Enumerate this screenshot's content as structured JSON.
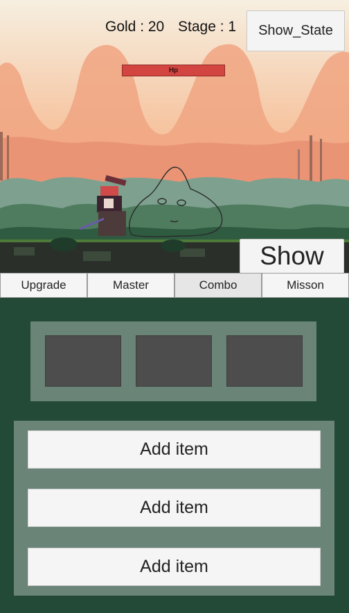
{
  "hud": {
    "gold_text": "Gold : 20",
    "stage_text": "Stage : 1",
    "show_state_label": "Show_State",
    "hp_label": "Hp",
    "show_label": "Show"
  },
  "tabs": [
    {
      "label": "Upgrade"
    },
    {
      "label": "Master"
    },
    {
      "label": "Combo",
      "active": true
    },
    {
      "label": "Misson"
    }
  ],
  "combo_slots": 3,
  "item_panel": {
    "buttons": [
      {
        "label": "Add item"
      },
      {
        "label": "Add item"
      },
      {
        "label": "Add item"
      }
    ]
  },
  "colors": {
    "panel_bg": "#224a36",
    "panel_inner": "#6a8478",
    "slot": "#4d4d4d",
    "hp_bar": "#d24540"
  }
}
